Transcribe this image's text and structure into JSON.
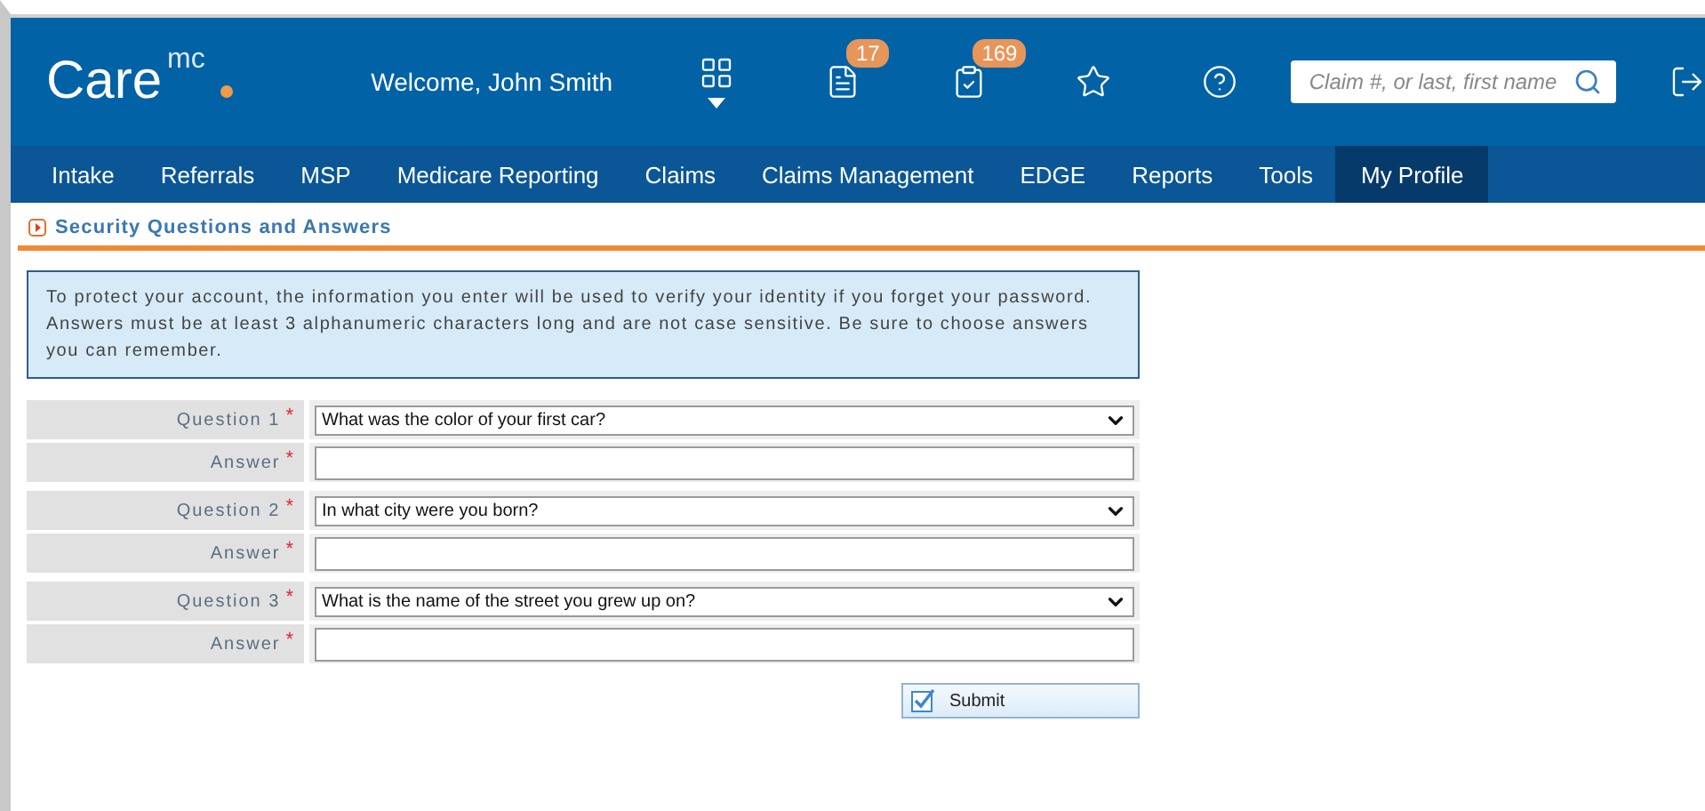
{
  "header": {
    "logo": {
      "text": "Care",
      "superscript": "mc"
    },
    "welcome": "Welcome, John Smith",
    "icons": [
      {
        "kind": "grid"
      },
      {
        "kind": "document",
        "badge": "17"
      },
      {
        "kind": "clipboard",
        "badge": "169"
      },
      {
        "kind": "star"
      },
      {
        "kind": "help"
      }
    ],
    "search": {
      "placeholder": "Claim #, or last, first name"
    }
  },
  "nav": {
    "items": [
      {
        "label": "Intake",
        "selected": false
      },
      {
        "label": "Referrals",
        "selected": false
      },
      {
        "label": "MSP",
        "selected": false
      },
      {
        "label": "Medicare Reporting",
        "selected": false
      },
      {
        "label": "Claims",
        "selected": false
      },
      {
        "label": "Claims Management",
        "selected": false
      },
      {
        "label": "EDGE",
        "selected": false
      },
      {
        "label": "Reports",
        "selected": false
      },
      {
        "label": "Tools",
        "selected": false
      },
      {
        "label": "My Profile",
        "selected": true
      }
    ]
  },
  "section": {
    "title": "Security Questions and Answers"
  },
  "info": "To protect your account, the information you enter will be used to verify your identity if you forget your password. Answers must be at least 3 alphanumeric characters long and are not case sensitive. Be sure to choose answers you can remember.",
  "questions": [
    {
      "label": "Question 1",
      "question": "What was the color of your first car?",
      "answer_label": "Answer",
      "required": "*"
    },
    {
      "label": "Question 2",
      "question": "In what city were you born?",
      "answer_label": "Answer",
      "required": "*"
    },
    {
      "label": "Question 3",
      "question": "What is the name of the street you grew up on?",
      "answer_label": "Answer",
      "required": "*"
    }
  ],
  "submit": {
    "label": "Submit"
  }
}
